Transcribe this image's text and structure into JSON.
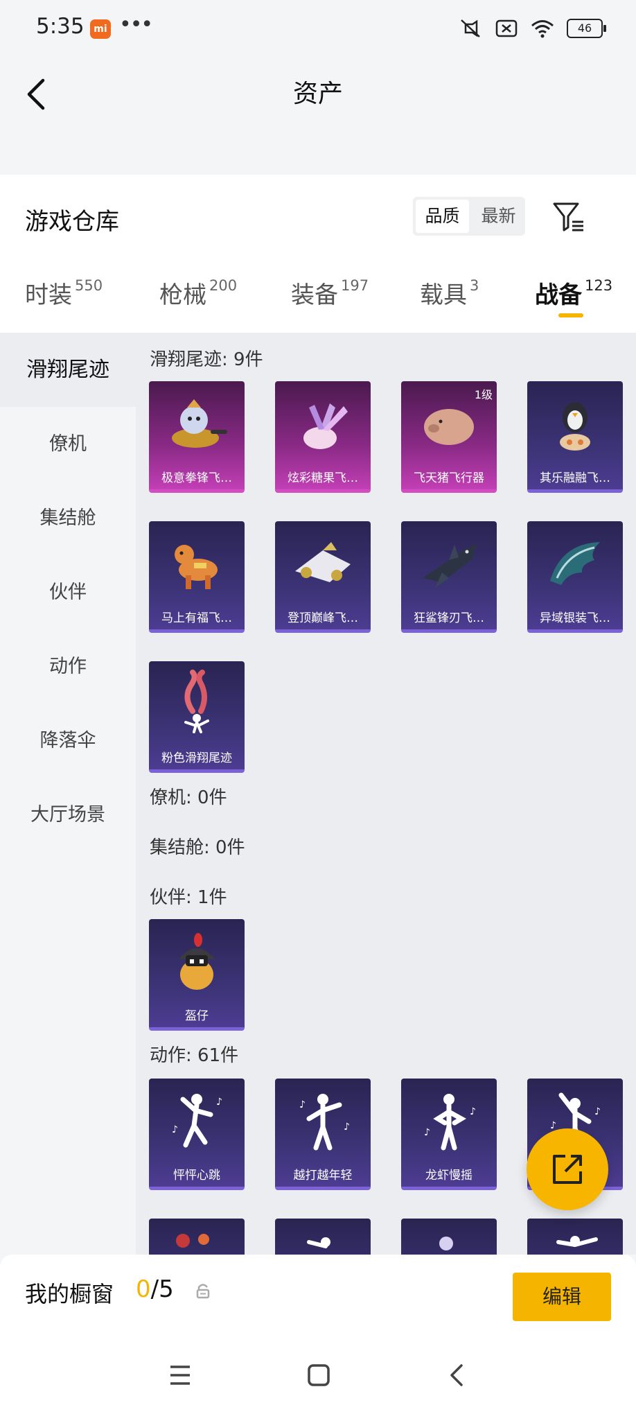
{
  "status_bar": {
    "time": "5:35",
    "app_badge": "mi",
    "battery": "46"
  },
  "page": {
    "title": "资产"
  },
  "header": {
    "title": "游戏仓库",
    "sort_options": [
      "品质",
      "最新"
    ]
  },
  "tabs": [
    {
      "label": "时装",
      "count": "550"
    },
    {
      "label": "枪械",
      "count": "200"
    },
    {
      "label": "装备",
      "count": "197"
    },
    {
      "label": "载具",
      "count": "3"
    },
    {
      "label": "战备",
      "count": "123"
    }
  ],
  "sidebar": {
    "items": [
      "滑翔尾迹",
      "僚机",
      "集结舱",
      "伙伴",
      "动作",
      "降落伞",
      "大厅场景"
    ]
  },
  "sections": {
    "trail": {
      "title": "滑翔尾迹: 9件",
      "items": [
        {
          "name": "极意拳锋飞…",
          "rarity": "pink",
          "icon": "kitten-glider-icon"
        },
        {
          "name": "炫彩糖果飞…",
          "rarity": "pink",
          "icon": "candy-glider-icon"
        },
        {
          "name": "飞天猪飞行器",
          "rarity": "pink",
          "icon": "pig-glider-icon",
          "badge": "1级"
        },
        {
          "name": "其乐融融飞…",
          "rarity": "purple",
          "icon": "penguin-glider-icon"
        },
        {
          "name": "马上有福飞…",
          "rarity": "purple",
          "icon": "horse-glider-icon"
        },
        {
          "name": "登顶巅峰飞…",
          "rarity": "purple",
          "icon": "jet-glider-icon"
        },
        {
          "name": "狂鲨锋刃飞…",
          "rarity": "purple",
          "icon": "shark-glider-icon"
        },
        {
          "name": "异域银装飞…",
          "rarity": "purple",
          "icon": "wing-glider-icon"
        },
        {
          "name": "粉色滑翔尾迹",
          "rarity": "purple",
          "icon": "pink-smoke-trail-icon"
        }
      ]
    },
    "wingman": {
      "title": "僚机: 0件"
    },
    "pod": {
      "title": "集结舱: 0件"
    },
    "partner": {
      "title": "伙伴: 1件",
      "items": [
        {
          "name": "盔仔",
          "rarity": "purple",
          "icon": "helmet-chick-icon"
        }
      ]
    },
    "emote": {
      "title": "动作: 61件",
      "items": [
        {
          "name": "怦怦心跳",
          "rarity": "purple",
          "icon": "dance-pose-icon"
        },
        {
          "name": "越打越年轻",
          "rarity": "purple",
          "icon": "dance-pose-icon"
        },
        {
          "name": "龙虾慢摇",
          "rarity": "purple",
          "icon": "dance-pose-icon"
        },
        {
          "name": "",
          "rarity": "purple",
          "icon": "dance-pose-icon"
        }
      ]
    }
  },
  "showcase": {
    "label": "我的橱窗",
    "used": "0",
    "sep_total": "/5",
    "edit_label": "编辑"
  }
}
